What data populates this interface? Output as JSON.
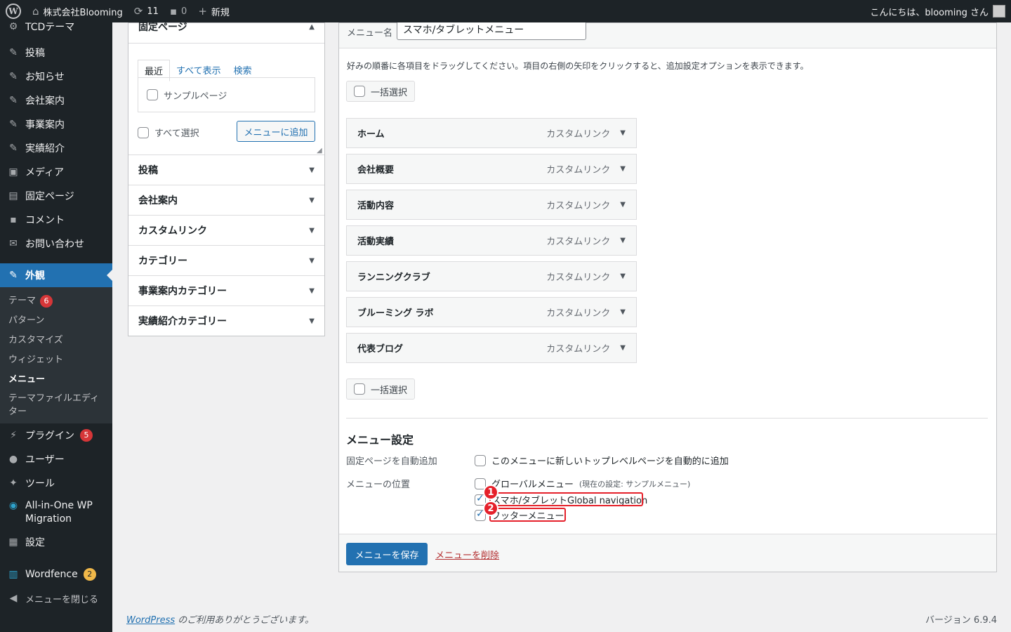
{
  "adminbar": {
    "site_name": "株式会社Blooming",
    "updates_count": "11",
    "comments_count": "0",
    "new_label": "新規",
    "greeting": "こんにちは、blooming さん"
  },
  "sidebar": {
    "items": [
      {
        "label": "TCDテーマ",
        "icon": "gear-icon"
      },
      {
        "label": "投稿",
        "icon": "pin-icon"
      },
      {
        "label": "お知らせ",
        "icon": "pin-icon"
      },
      {
        "label": "会社案内",
        "icon": "pin-icon"
      },
      {
        "label": "事業案内",
        "icon": "pin-icon"
      },
      {
        "label": "実績紹介",
        "icon": "pin-icon"
      },
      {
        "label": "メディア",
        "icon": "media-icon"
      },
      {
        "label": "固定ページ",
        "icon": "page-icon"
      },
      {
        "label": "コメント",
        "icon": "comment-icon"
      },
      {
        "label": "お問い合わせ",
        "icon": "mail-icon"
      },
      {
        "label": "外観",
        "icon": "brush-icon"
      }
    ],
    "submenu": [
      {
        "label": "テーマ",
        "badge": "6"
      },
      {
        "label": "パターン"
      },
      {
        "label": "カスタマイズ"
      },
      {
        "label": "ウィジェット"
      },
      {
        "label": "メニュー"
      },
      {
        "label": "テーマファイルエディター"
      }
    ],
    "items_after": [
      {
        "label": "プラグイン",
        "badge": "5",
        "icon": "plugin-icon"
      },
      {
        "label": "ユーザー",
        "icon": "user-icon"
      },
      {
        "label": "ツール",
        "icon": "wrench-icon"
      },
      {
        "label": "All-in-One WP Migration",
        "icon": "migration-icon"
      },
      {
        "label": "設定",
        "icon": "settings-icon"
      },
      {
        "label": "Wordfence",
        "badge": "2",
        "icon": "wordfence-icon"
      },
      {
        "label": "メニューを閉じる",
        "icon": "collapse-icon"
      }
    ]
  },
  "left_panel": {
    "title": "固定ページ",
    "tabs": [
      "最近",
      "すべて表示",
      "検索"
    ],
    "page_item": "サンプルページ",
    "select_all": "すべて選択",
    "add_button": "メニューに追加",
    "accordions": [
      "投稿",
      "会社案内",
      "カスタムリンク",
      "カテゴリー",
      "事業案内カテゴリー",
      "実績紹介カテゴリー"
    ]
  },
  "right_panel": {
    "menu_name_label": "メニュー名",
    "menu_name_value": "スマホ/タブレットメニュー",
    "instructions": "好みの順番に各項目をドラッグしてください。項目の右側の矢印をクリックすると、追加設定オプションを表示できます。",
    "bulk_select": "一括選択",
    "menu_items": [
      {
        "title": "ホーム",
        "type": "カスタムリンク"
      },
      {
        "title": "会社概要",
        "type": "カスタムリンク"
      },
      {
        "title": "活動内容",
        "type": "カスタムリンク"
      },
      {
        "title": "活動実績",
        "type": "カスタムリンク"
      },
      {
        "title": "ランニングクラブ",
        "type": "カスタムリンク"
      },
      {
        "title": "ブルーミング ラボ",
        "type": "カスタムリンク"
      },
      {
        "title": "代表ブログ",
        "type": "カスタムリンク"
      }
    ],
    "settings_title": "メニュー設定",
    "auto_add_label": "固定ページを自動追加",
    "auto_add_option": "このメニューに新しいトップレベルページを自動的に追加",
    "location_label": "メニューの位置",
    "locations": [
      {
        "label": "グローバルメニュー",
        "note": "(現在の設定: サンプルメニュー)",
        "checked": false
      },
      {
        "label": "スマホ/タブレットGlobal navigation",
        "checked": true
      },
      {
        "label": "フッターメニュー",
        "checked": true
      }
    ],
    "annotations": [
      "1",
      "2"
    ],
    "save_button": "メニューを保存",
    "delete_link": "メニューを削除"
  },
  "footer": {
    "wp_link": "WordPress",
    "thanks": " のご利用ありがとうございます。",
    "version": "バージョン 6.9.4"
  }
}
